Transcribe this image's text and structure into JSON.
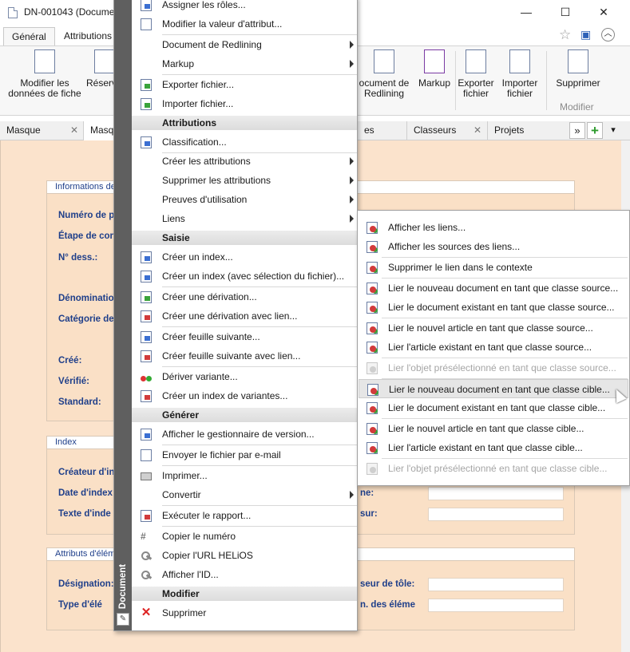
{
  "window": {
    "title": "DN-001043 (Docume",
    "controls": {
      "minimize": "—",
      "maximize": "☐",
      "close": "✕"
    }
  },
  "ribbon": {
    "tabs": [
      {
        "label": "Général",
        "active": true
      },
      {
        "label": "Attributions",
        "active": false
      }
    ],
    "buttons": {
      "modifier_donnees": "Modifier les données de fiche",
      "reserver": "Réserv",
      "document_redlining": "ocument de Redlining",
      "markup": "Markup",
      "exporter_fichier": "Exporter fichier",
      "importer_fichier": "Importer fichier",
      "supprimer": "Supprimer"
    },
    "group_modifier": "Modifier",
    "icons": {
      "star": "☆",
      "window": "▣",
      "collapse": "︿"
    }
  },
  "doc_tabs": [
    {
      "label": "Masque"
    },
    {
      "label": "Masq"
    },
    {
      "label": "es"
    },
    {
      "label": "Classeurs"
    },
    {
      "label": "Projets"
    }
  ],
  "doc_tab_controls": {
    "overflow": "»",
    "add": "+",
    "dropdown": "▾",
    "close": "✕"
  },
  "panels": {
    "info": {
      "title": "Informations de",
      "labels": [
        "Numéro de p",
        "Étape de con",
        "N° dess.:",
        "Dénominatio",
        "Catégorie de",
        "Créé:",
        "Vérifié:",
        "Standard:"
      ]
    },
    "index": {
      "title": "Index",
      "labels": [
        "Créateur d'in",
        "Date d'index",
        "Texte d'inde"
      ],
      "right_labels": [
        "ne:",
        "sur:"
      ]
    },
    "attributs": {
      "title": "Attributs d'élém",
      "labels": [
        "Désignation:",
        "Type d'élé"
      ],
      "right_labels": [
        "seur de tôle:",
        "n. des éléme"
      ]
    }
  },
  "context_menu": {
    "side_label": "Document",
    "items": {
      "assigner": "Assigner les rôles...",
      "modifier_valeur": "Modifier la valeur d'attribut...",
      "doc_redlining": "Document de Redlining",
      "markup": "Markup",
      "exporter": "Exporter fichier...",
      "importer": "Importer fichier...",
      "h_attributions": "Attributions",
      "classification": "Classification...",
      "creer_attributions": "Créer les attributions",
      "supprimer_attributions": "Supprimer les attributions",
      "preuves": "Preuves d'utilisation",
      "liens": "Liens",
      "h_saisie": "Saisie",
      "creer_index": "Créer un index...",
      "creer_index_sel": "Créer un index (avec sélection du fichier)...",
      "creer_derivation": "Créer une dérivation...",
      "creer_derivation_lien": "Créer une dérivation avec lien...",
      "creer_feuille": "Créer feuille suivante...",
      "creer_feuille_lien": "Créer feuille suivante avec lien...",
      "deriver_variante": "Dériver variante...",
      "creer_index_variantes": "Créer un index de variantes...",
      "h_generer": "Générer",
      "gestionnaire_version": "Afficher le gestionnaire de version...",
      "envoyer_email": "Envoyer le fichier par e-mail",
      "imprimer": "Imprimer...",
      "convertir": "Convertir",
      "executer_rapport": "Exécuter le rapport...",
      "copier_numero": "Copier le numéro",
      "copier_url": "Copier l'URL HELiOS",
      "afficher_id": "Afficher l'ID...",
      "h_modifier": "Modifier",
      "supprimer": "Supprimer"
    }
  },
  "submenu": {
    "items": [
      {
        "label": "Afficher les liens...",
        "disabled": false
      },
      {
        "label": "Afficher les sources des liens...",
        "disabled": false
      },
      {
        "label": "Supprimer le lien dans le contexte",
        "disabled": false
      },
      {
        "label": "Lier le nouveau document en tant que classe source...",
        "disabled": false
      },
      {
        "label": "Lier le document existant en tant que classe source...",
        "disabled": false
      },
      {
        "label": "Lier le nouvel article en tant que classe source...",
        "disabled": false
      },
      {
        "label": "Lier l'article existant en tant que classe source...",
        "disabled": false
      },
      {
        "label": "Lier l'objet présélectionné en tant que classe source...",
        "disabled": true
      },
      {
        "label": "Lier le nouveau document en tant que classe cible...",
        "disabled": false,
        "hover": true
      },
      {
        "label": "Lier le document existant en tant que classe cible...",
        "disabled": false
      },
      {
        "label": "Lier le nouvel article en tant que classe cible...",
        "disabled": false
      },
      {
        "label": "Lier l'article existant en tant que classe cible...",
        "disabled": false
      },
      {
        "label": "Lier l'objet présélectionné en tant que classe cible...",
        "disabled": true
      }
    ]
  }
}
